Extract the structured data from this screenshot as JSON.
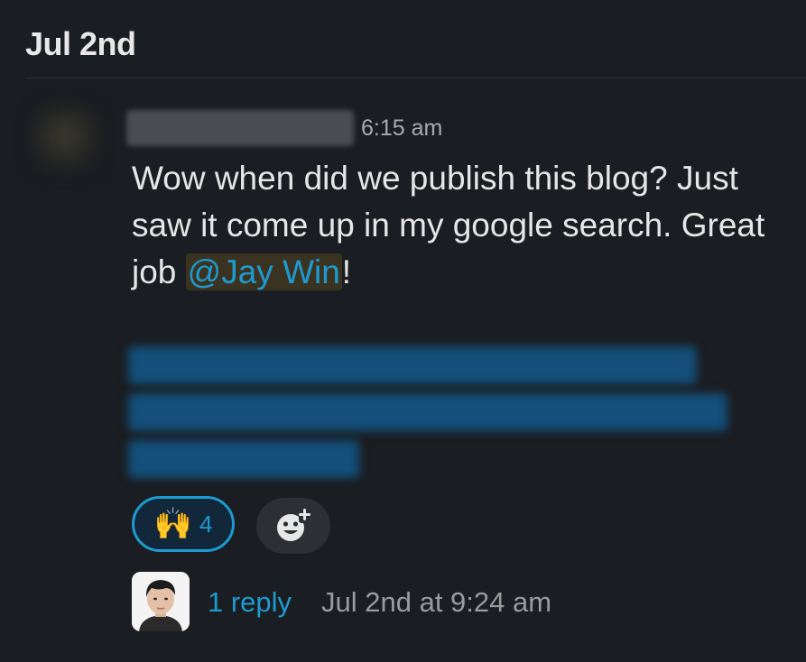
{
  "date_header": "Jul 2nd",
  "message": {
    "time": "6:15 am",
    "text_before_mention": "Wow when did we publish this blog? Just saw it come up in my google search. Great job ",
    "mention": "@Jay Win",
    "text_after_mention": "!"
  },
  "reactions": [
    {
      "emoji": "🙌",
      "emoji_icon": "raising-hands-icon",
      "count": "4"
    }
  ],
  "add_reaction_icon": "add-reaction-icon",
  "thread": {
    "reply_count_label": "1 reply",
    "last_reply": "Jul 2nd at 9:24 am"
  },
  "colors": {
    "background": "#1a1d21",
    "link_blue": "#1d9bd1",
    "mention_highlight": "#3a3220",
    "muted_text": "#ababad"
  }
}
